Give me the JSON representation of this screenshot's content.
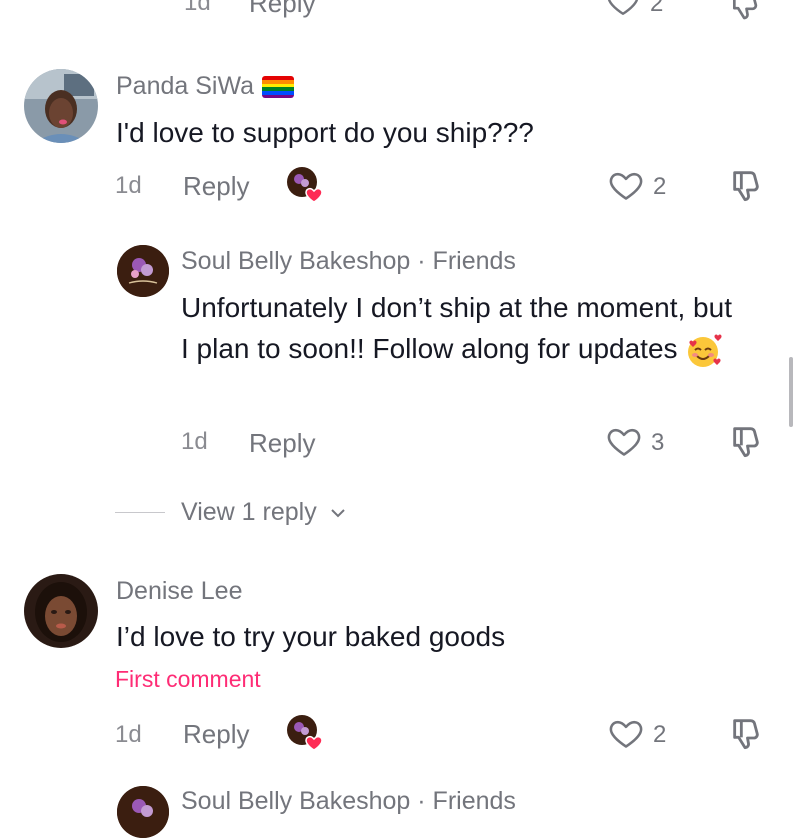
{
  "top_partial": {
    "time": "1d",
    "reply_label": "Reply",
    "likes": "2"
  },
  "comments": [
    {
      "username": "Panda SiWa",
      "text": "I'd love to support do you ship???",
      "time": "1d",
      "reply_label": "Reply",
      "likes": "2",
      "creator_liked": true
    },
    {
      "username": "Denise Lee",
      "text": "I’d love to try your baked goods",
      "badge": "First comment",
      "time": "1d",
      "reply_label": "Reply",
      "likes": "2",
      "creator_liked": true
    }
  ],
  "reply": {
    "username": "Soul Belly Bakeshop",
    "separator": "·",
    "relationship": "Friends",
    "text": "Unfortunately I don’t ship at the moment, but I plan to soon!! Follow along for updates",
    "time": "1d",
    "reply_label": "Reply",
    "likes": "3"
  },
  "view_replies_label": "View 1 reply",
  "bottom_partial": {
    "username": "Soul Belly Bakeshop",
    "separator": "·",
    "relationship": "Friends"
  },
  "icons": {
    "like": "heart-outline-icon",
    "dislike": "thumbs-down-icon",
    "expand": "chevron-down-icon",
    "creator_liked": "creator-liked-heart-icon",
    "emoji": "smiling-face-with-hearts-emoji"
  },
  "colors": {
    "accent": "#fe2c75",
    "username": "#73757c",
    "text": "#161823",
    "meta": "#8a8b91"
  }
}
